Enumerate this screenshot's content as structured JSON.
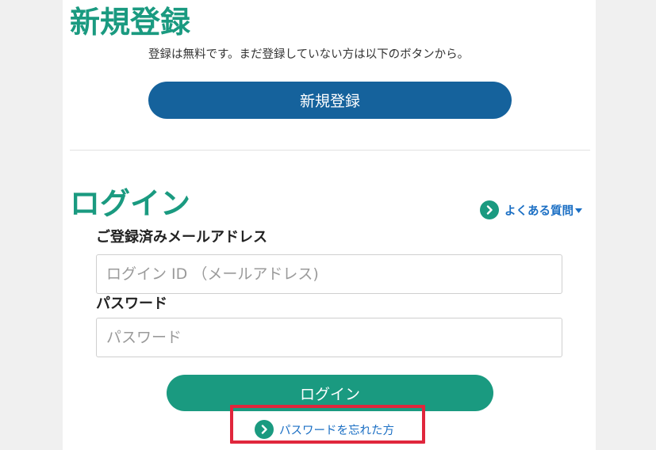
{
  "register": {
    "heading": "新規登録",
    "description": "登録は無料です。まだ登録していない方は以下のボタンから。",
    "button_label": "新規登録"
  },
  "login": {
    "heading": "ログイン",
    "faq_link": "よくある質問",
    "email_label": "ご登録済みメールアドレス",
    "email_placeholder": "ログイン ID （メールアドレス)",
    "email_value": "",
    "password_label": "パスワード",
    "password_placeholder": "パスワード",
    "password_value": "",
    "button_label": "ログイン",
    "forgot_link": "パスワードを忘れた方"
  },
  "icons": {
    "link_arrow": "chevron-right-circle-icon",
    "faq_caret": "caret-down-icon"
  },
  "colors": {
    "accent_green": "#1a9a80",
    "register_blue": "#15629c",
    "link_blue": "#1b6fc4",
    "highlight_red": "#e0263c",
    "background": "#f0f0f0"
  }
}
